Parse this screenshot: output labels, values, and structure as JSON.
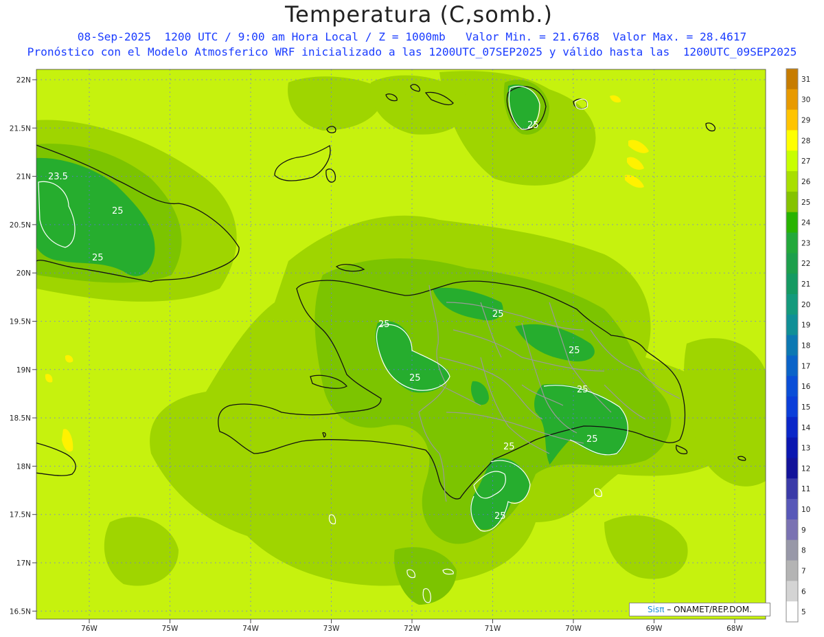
{
  "title": "Temperatura (C,somb.)",
  "subtitle1": "08-Sep-2025  1200 UTC / 9:00 am Hora Local / Z = 1000mb   Valor Min. = 21.6768  Valor Max. = 28.4617",
  "subtitle2": "Pronóstico con el Modelo Atmosferico WRF inicializado a las 1200UTC_07SEP2025 y válido hasta las  1200UTC_09SEP2025",
  "credit": {
    "brand": "Sisπ",
    "text": " – ONAMET/REP.DOM."
  },
  "axes": {
    "lat_labels": [
      "22N",
      "21.5N",
      "21N",
      "20.5N",
      "20N",
      "19.5N",
      "19N",
      "18.5N",
      "18N",
      "17.5N",
      "17N",
      "16.5N"
    ],
    "lon_labels": [
      "76W",
      "75W",
      "74W",
      "73W",
      "72W",
      "71W",
      "70W",
      "69W",
      "68W"
    ]
  },
  "colorbar": {
    "labels": [
      "31",
      "30",
      "29",
      "28",
      "27",
      "26",
      "25",
      "24",
      "23",
      "22",
      "21",
      "20",
      "19",
      "18",
      "17",
      "16",
      "15",
      "14",
      "13",
      "12",
      "11",
      "10",
      "9",
      "8",
      "7",
      "6",
      "5"
    ],
    "colors": [
      "#c77c00",
      "#e89a00",
      "#ffc400",
      "#ffff00",
      "#c8ff00",
      "#a8df00",
      "#85c300",
      "#28b300",
      "#22a83a",
      "#1d9f4c",
      "#159a62",
      "#149a7c",
      "#108f96",
      "#0c78b2",
      "#0a63c8",
      "#0a4ed7",
      "#0b3ed9",
      "#0a26c8",
      "#0a16b0",
      "#12129a",
      "#3a3aa8",
      "#5858b8",
      "#7a72b2",
      "#9898a8",
      "#b4b4b4",
      "#d4d4d4",
      "#ffffff"
    ]
  },
  "contour_labels": [
    "23.5",
    "25",
    "25",
    "25",
    "25",
    "25",
    "25",
    "25",
    "25",
    "25",
    "25",
    "25"
  ],
  "colors": {
    "background_field": "#c6f20e",
    "level_26": "#9fd500",
    "level_25": "#7cc400",
    "level_24": "#26ad2e",
    "coast": "#111111",
    "provinces": "#9a9a9a",
    "grid": "#6a6aff"
  }
}
